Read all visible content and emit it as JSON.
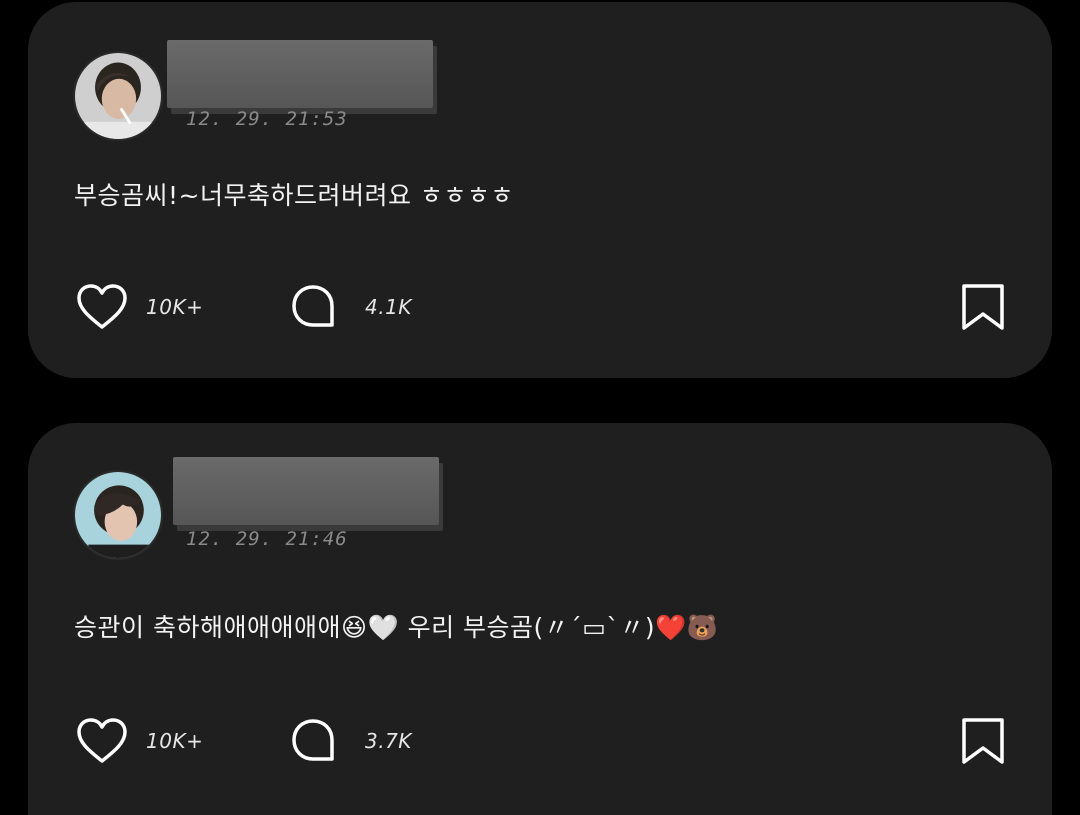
{
  "posts": [
    {
      "timestamp": "12. 29. 21:53",
      "text": "부승곰씨!~너무축하드려버려요 ㅎㅎㅎㅎ",
      "likes": "10K+",
      "comments": "4.1K"
    },
    {
      "timestamp": "12. 29. 21:46",
      "text": "승관이 축하해애애애애애😆🤍 우리 부승곰(〃´▭`〃)❤️🐻",
      "likes": "10K+",
      "comments": "3.7K"
    }
  ],
  "colors": {
    "background": "#000000",
    "card": "#1f1f1f",
    "text": "#f2f2f2",
    "muted": "#8a8a8a",
    "redaction": "#606060"
  },
  "icons": {
    "like": "heart-outline-icon",
    "comment": "speech-bubble-icon",
    "save": "bookmark-outline-icon"
  }
}
